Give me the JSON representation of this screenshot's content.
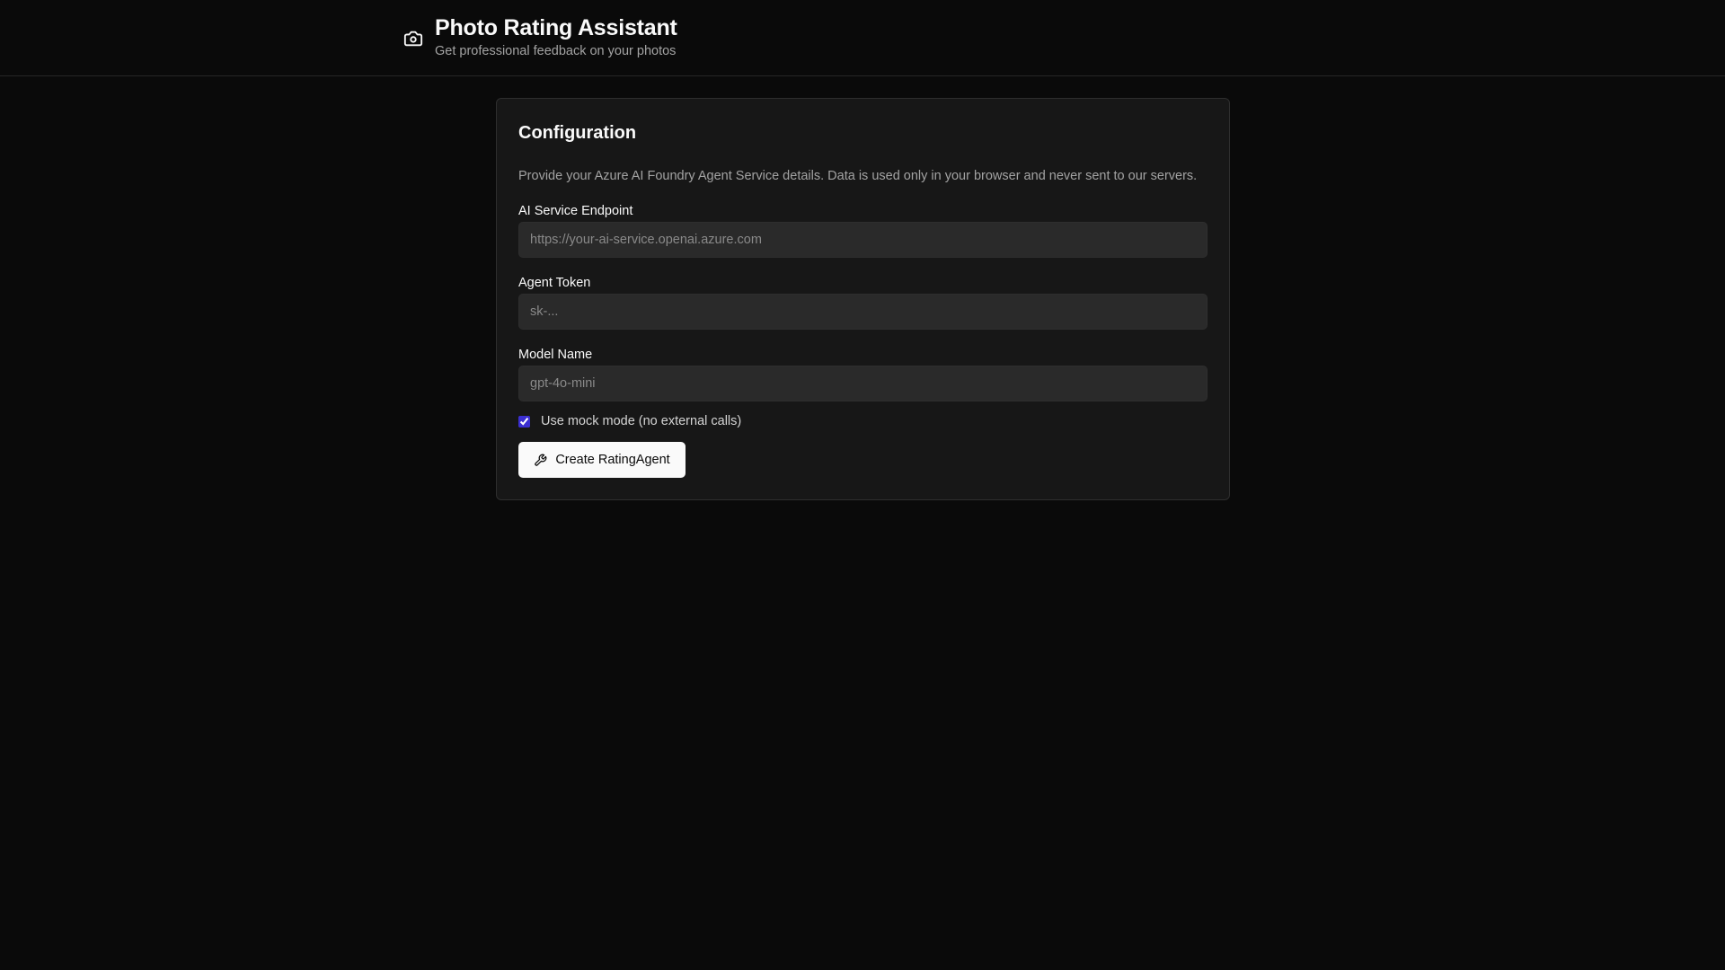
{
  "header": {
    "icon": "camera-icon",
    "title": "Photo Rating Assistant",
    "subtitle": "Get professional feedback on your photos"
  },
  "config": {
    "title": "Configuration",
    "description": "Provide your Azure AI Foundry Agent Service details. Data is used only in your browser and never sent to our servers.",
    "fields": [
      {
        "label": "AI Service Endpoint",
        "value": "",
        "placeholder": "https://your-ai-service.openai.azure.com"
      },
      {
        "label": "Agent Token",
        "value": "",
        "placeholder": "sk-..."
      },
      {
        "label": "Model Name",
        "value": "",
        "placeholder": "gpt-4o-mini"
      }
    ],
    "mock_mode": {
      "label": "Use mock mode (no external calls)",
      "checked": true
    },
    "create_button": {
      "icon": "wrench-icon",
      "label": "Create RatingAgent"
    }
  },
  "colors": {
    "background": "#0a0a0a",
    "card": "#171717",
    "input": "#2a2a2a",
    "accent": "#3b2fd1",
    "button": "#fafafa"
  }
}
